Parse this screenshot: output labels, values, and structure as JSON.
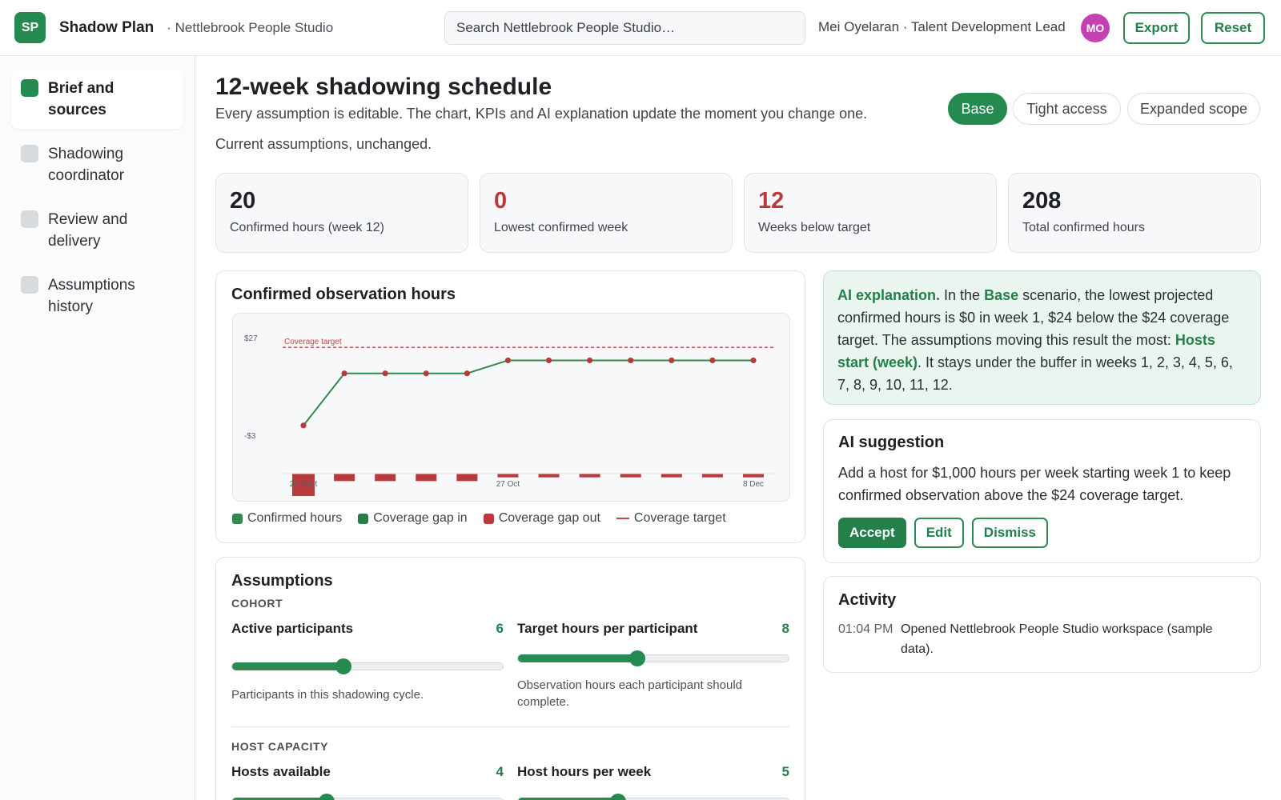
{
  "header": {
    "logo": "SP",
    "title": "Shadow Plan",
    "workspace": "· Nettlebrook People Studio",
    "search_placeholder": "Search Nettlebrook People Studio…",
    "user": "Mei Oyelaran · Talent Development Lead",
    "avatar": "MO",
    "export_label": "Export",
    "reset_label": "Reset"
  },
  "sidebar": {
    "items": [
      {
        "label": "Brief and sources",
        "active": true
      },
      {
        "label": "Shadowing coordinator",
        "active": false
      },
      {
        "label": "Review and delivery",
        "active": false
      },
      {
        "label": "Assumptions history",
        "active": false
      }
    ]
  },
  "page": {
    "title": "12-week shadowing schedule",
    "description": "Every assumption is editable. The chart, KPIs and AI explanation update the moment you change one.",
    "status": "Current assumptions, unchanged.",
    "scenarios": [
      "Base",
      "Tight access",
      "Expanded scope"
    ],
    "active_scenario": "Base"
  },
  "kpis": [
    {
      "value": "20",
      "label": "Confirmed hours (week 12)",
      "alert": false
    },
    {
      "value": "0",
      "label": "Lowest confirmed week",
      "alert": true
    },
    {
      "value": "12",
      "label": "Weeks below target",
      "alert": true
    },
    {
      "value": "208",
      "label": "Total confirmed hours",
      "alert": false
    }
  ],
  "chart_card": {
    "title": "Confirmed observation hours",
    "legend": [
      "Confirmed hours",
      "Coverage gap in",
      "Coverage gap out",
      "Coverage target"
    ]
  },
  "colors": {
    "accent": "#258a4f",
    "line": "#2e8b4c",
    "point": "#b83a3a",
    "gap_out": "#b83a3a",
    "target": "#c24646"
  },
  "chart_data": {
    "type": "line",
    "x": [
      1,
      2,
      3,
      4,
      5,
      6,
      7,
      8,
      9,
      10,
      11,
      12
    ],
    "x_tick_labels": [
      {
        "x": 1,
        "label": "29 Sept"
      },
      {
        "x": 6,
        "label": "27 Oct"
      },
      {
        "x": 12,
        "label": "8 Dec"
      }
    ],
    "y_tick_labels": [
      {
        "y": 27,
        "label": "$27"
      },
      {
        "y": -3,
        "label": "-$3"
      }
    ],
    "ylim": [
      -3,
      27
    ],
    "target": {
      "label": "Coverage target",
      "value": 24
    },
    "series": [
      {
        "name": "Confirmed hours",
        "values": [
          0,
          16,
          16,
          16,
          16,
          20,
          20,
          20,
          20,
          20,
          20,
          20
        ]
      },
      {
        "name": "Coverage gap out",
        "values": [
          24,
          8,
          8,
          8,
          8,
          4,
          4,
          4,
          4,
          4,
          4,
          4
        ]
      }
    ]
  },
  "ai_explanation": {
    "lead": "AI explanation.",
    "t1": " In the ",
    "scenario": "Base",
    "t2": " scenario, the lowest projected confirmed hours is $0 in week 1, $24 below the $24 coverage target. The assumptions moving this result the most: ",
    "driver": "Hosts start (week)",
    "t3": ". It stays under the buffer in weeks 1, 2, 3, 4, 5, 6, 7, 8, 9, 10, 11, 12."
  },
  "ai_suggestion": {
    "title": "AI suggestion",
    "text": "Add a host for $1,000 hours per week starting week 1 to keep confirmed observation above the $24 coverage target.",
    "accept": "Accept",
    "edit": "Edit",
    "dismiss": "Dismiss"
  },
  "activity": {
    "title": "Activity",
    "entries": [
      {
        "time": "01:04 PM",
        "text": "Opened Nettlebrook People Studio workspace (sample data)."
      }
    ]
  },
  "assumptions": {
    "title": "Assumptions",
    "sections": [
      {
        "label": "COHORT",
        "sliders": [
          {
            "label": "Active participants",
            "value": "6",
            "fraction": 0.41,
            "help": "Participants in this shadowing cycle."
          },
          {
            "label": "Target hours per participant",
            "value": "8",
            "fraction": 0.44,
            "help": "Observation hours each participant should complete."
          }
        ]
      },
      {
        "label": "HOST CAPACITY",
        "sliders": [
          {
            "label": "Hosts available",
            "value": "4",
            "fraction": 0.35,
            "help": ""
          },
          {
            "label": "Host hours per week",
            "value": "5",
            "fraction": 0.37,
            "help": ""
          }
        ]
      }
    ]
  }
}
